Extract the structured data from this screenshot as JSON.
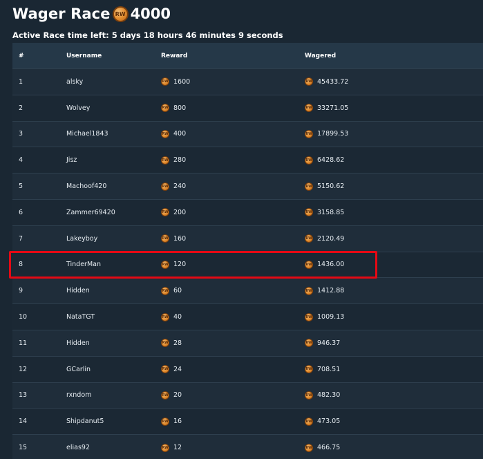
{
  "header": {
    "title": "Wager Race",
    "coin_label": "RW",
    "prize_amount": "4000",
    "timer_text": "Active Race time left: 5 days 18 hours 46 minutes 9 seconds"
  },
  "table": {
    "columns": [
      "#",
      "Username",
      "Reward",
      "Wagered"
    ],
    "rows": [
      {
        "rank": "1",
        "username": "alsky",
        "reward": "1600",
        "wagered": "45433.72"
      },
      {
        "rank": "2",
        "username": "Wolvey",
        "reward": "800",
        "wagered": "33271.05"
      },
      {
        "rank": "3",
        "username": "Michael1843",
        "reward": "400",
        "wagered": "17899.53"
      },
      {
        "rank": "4",
        "username": "Jisz",
        "reward": "280",
        "wagered": "6428.62"
      },
      {
        "rank": "5",
        "username": "Machoof420",
        "reward": "240",
        "wagered": "5150.62"
      },
      {
        "rank": "6",
        "username": "Zammer69420",
        "reward": "200",
        "wagered": "3158.85"
      },
      {
        "rank": "7",
        "username": "Lakeyboy",
        "reward": "160",
        "wagered": "2120.49"
      },
      {
        "rank": "8",
        "username": "TinderMan",
        "reward": "120",
        "wagered": "1436.00"
      },
      {
        "rank": "9",
        "username": "Hidden",
        "reward": "60",
        "wagered": "1412.88"
      },
      {
        "rank": "10",
        "username": "NataTGT",
        "reward": "40",
        "wagered": "1009.13"
      },
      {
        "rank": "11",
        "username": "Hidden",
        "reward": "28",
        "wagered": "946.37"
      },
      {
        "rank": "12",
        "username": "GCarlin",
        "reward": "24",
        "wagered": "708.51"
      },
      {
        "rank": "13",
        "username": "rxndom",
        "reward": "20",
        "wagered": "482.30"
      },
      {
        "rank": "14",
        "username": "Shipdanut5",
        "reward": "16",
        "wagered": "473.05"
      },
      {
        "rank": "15",
        "username": "elias92",
        "reward": "12",
        "wagered": "466.75"
      }
    ]
  },
  "highlight": {
    "row_index": 7,
    "color": "#e50914"
  },
  "colors": {
    "background": "#1a2733",
    "header_row": "#253848",
    "coin": "#e08a2c"
  },
  "icons": {
    "coin": "coin-icon"
  }
}
